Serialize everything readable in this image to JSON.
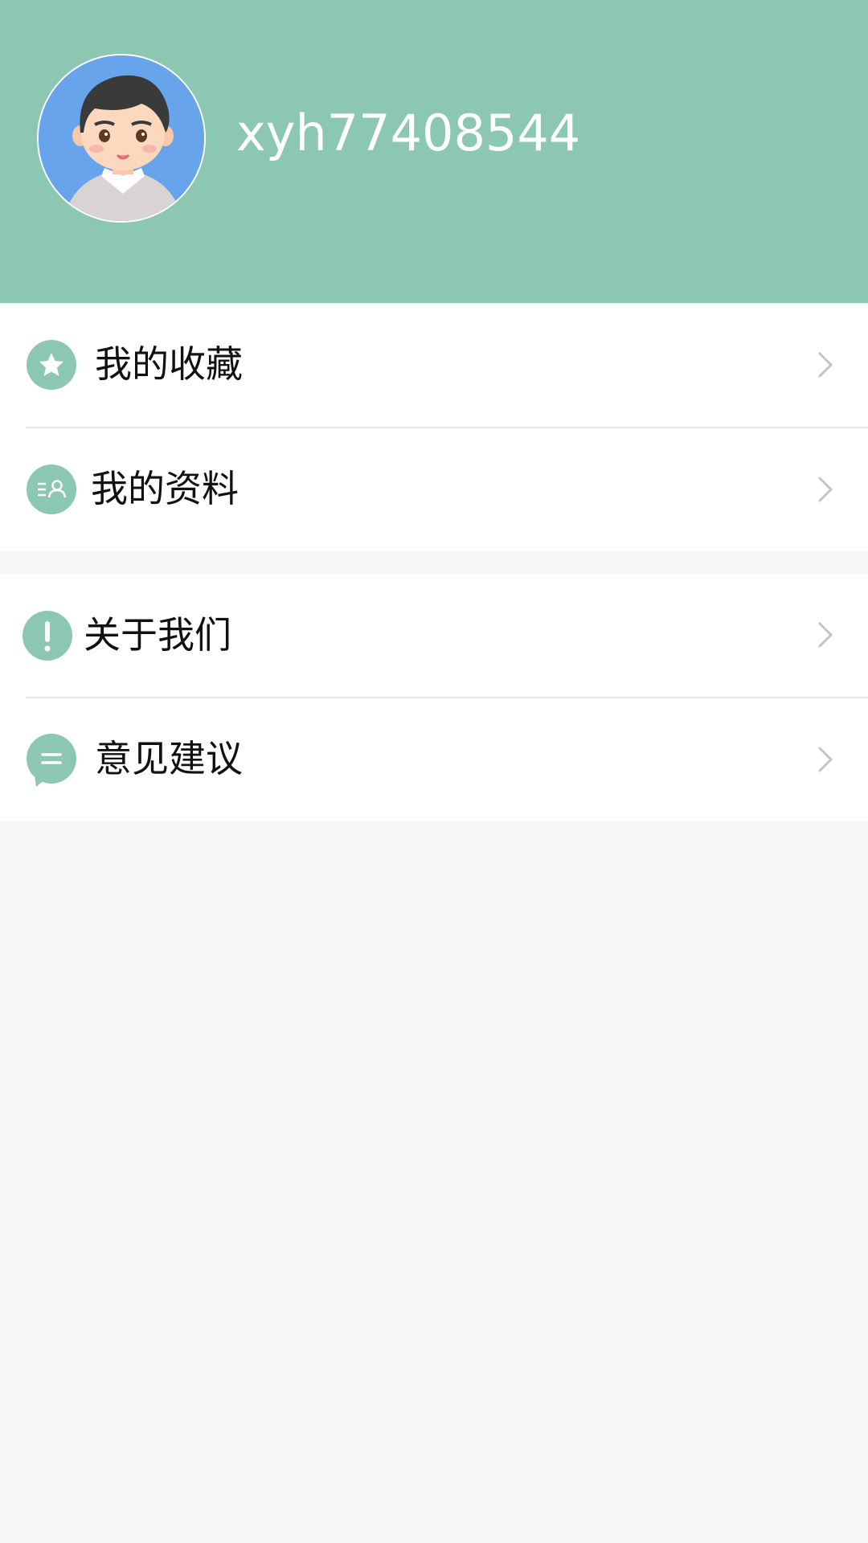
{
  "profile": {
    "username": "xyh77408544",
    "avatar_icon": "user-avatar-icon",
    "header_color": "#8cc7b3"
  },
  "menu": {
    "group1": [
      {
        "label": "我的收藏",
        "icon": "star-icon"
      },
      {
        "label": "我的资料",
        "icon": "profile-card-icon"
      }
    ],
    "group2": [
      {
        "label": "关于我们",
        "icon": "exclamation-icon"
      },
      {
        "label": "意见建议",
        "icon": "chat-bubble-icon"
      }
    ]
  },
  "colors": {
    "accent": "#8cc7b3",
    "background": "#f6f5f8",
    "chevron": "#c4c4c4"
  }
}
